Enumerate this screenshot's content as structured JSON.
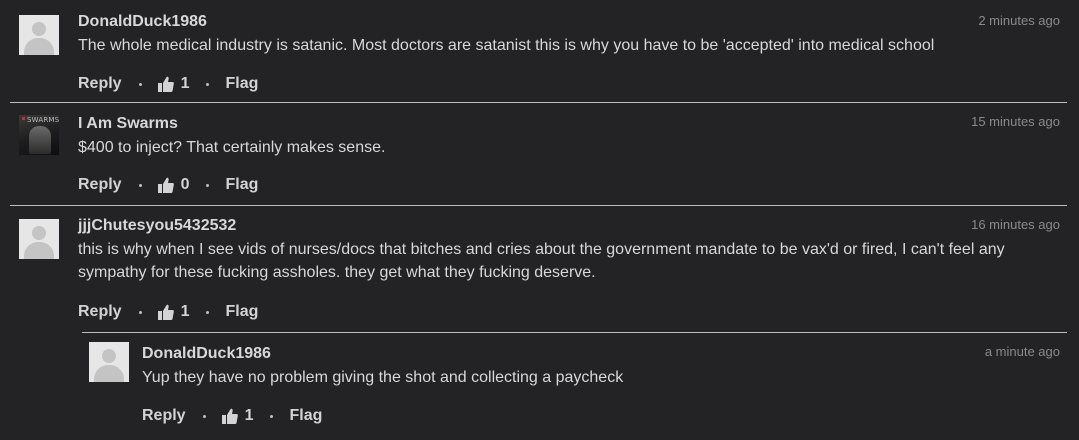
{
  "comments": [
    {
      "username": "DonaldDuck1986",
      "timestamp": "2 minutes ago",
      "text": "The whole medical industry is satanic. Most doctors are satanist this is why you have to be 'accepted' into medical school",
      "avatar": "default-avatar",
      "actions": {
        "reply": "Reply",
        "likes": "1",
        "flag": "Flag"
      }
    },
    {
      "username": "I Am Swarms",
      "timestamp": "15 minutes ago",
      "text": "$400 to inject? That certainly makes sense.",
      "avatar": "photo-avatar",
      "avatar_text": "SWARMS",
      "actions": {
        "reply": "Reply",
        "likes": "0",
        "flag": "Flag"
      }
    },
    {
      "username": "jjjChutesyou5432532",
      "timestamp": "16 minutes ago",
      "text": "this is why when I see vids of nurses/docs that bitches and cries about the government mandate to be vax'd or fired, I can't feel any sympathy for these fucking assholes. they get what they fucking deserve.",
      "avatar": "default-avatar",
      "actions": {
        "reply": "Reply",
        "likes": "1",
        "flag": "Flag"
      }
    },
    {
      "username": "DonaldDuck1986",
      "timestamp": "a minute ago",
      "text": "Yup they have no problem giving the shot and collecting a paycheck",
      "avatar": "default-avatar",
      "is_reply": true,
      "actions": {
        "reply": "Reply",
        "likes": "1",
        "flag": "Flag"
      }
    }
  ],
  "colors": {
    "background": "#232224",
    "text": "#d8d8d8",
    "timestamp": "#8a8a8a",
    "divider": "#bdbdbd"
  }
}
